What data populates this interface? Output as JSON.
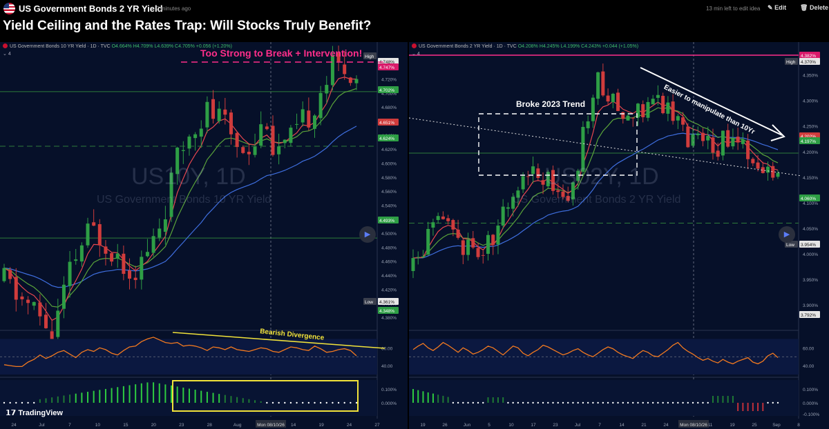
{
  "header": {
    "symbol_title": "US Government Bonds 2 YR Yield",
    "posted_ago": "2 minutes ago",
    "edit_time_left": "13 min left to edit idea",
    "edit_label": "Edit",
    "delete_label": "Delete",
    "idea_title": "Yield Ceiling and the Rates Trap: Will Stocks Truly Benefit?",
    "brand": "TradingView"
  },
  "left_pane": {
    "legend": "US Government Bonds 10 YR Yield · 1D · TVC",
    "ohlc": "O4.664%  H4.709%  L4.639%  C4.705%  +0.056 (+1.20%)",
    "indicator_count": "4",
    "watermark_symbol": "US10Y, 1D",
    "watermark_name": "US Government Bonds 10 YR Yield",
    "annotation": "Too Strong to Break + Intervention!",
    "divergence_label": "Bearish Divergence",
    "crosshair_date": "Mon 08/10/26",
    "price_tags": [
      {
        "text": "High",
        "kind": "label"
      },
      {
        "text": "4.748%",
        "kind": "high"
      },
      {
        "text": "4.747%",
        "kind": "magenta"
      },
      {
        "text": "4.702%",
        "kind": "green"
      },
      {
        "text": "4.651%",
        "kind": "red"
      },
      {
        "text": "4.624%",
        "kind": "green"
      },
      {
        "text": "4.493%",
        "kind": "green"
      },
      {
        "text": "Low",
        "kind": "label"
      },
      {
        "text": "4.361%",
        "kind": "low"
      },
      {
        "text": "4.348%",
        "kind": "green"
      }
    ]
  },
  "right_pane": {
    "legend": "US Government Bonds 2 YR Yield · 1D · TVC",
    "ohlc": "O4.208%  H4.245%  L4.199%  C4.243%  +0.044 (+1.05%)",
    "indicator_count": "4",
    "watermark_symbol": "US02Y, 1D",
    "watermark_name": "US Government Bonds 2 YR Yield",
    "annotation_trend": "Broke 2023 Trend",
    "annotation_arrow": "Easier to manipulate than 10Yr",
    "crosshair_date": "Mon 08/10/26",
    "price_tags": [
      {
        "text": "4.382%",
        "kind": "magenta"
      },
      {
        "text": "High",
        "kind": "label"
      },
      {
        "text": "4.370%",
        "kind": "high"
      },
      {
        "text": "4.202%",
        "kind": "red"
      },
      {
        "text": "4.197%",
        "kind": "green"
      },
      {
        "text": "4.060%",
        "kind": "green"
      },
      {
        "text": "Low",
        "kind": "label"
      },
      {
        "text": "3.954%",
        "kind": "low"
      },
      {
        "text": "3.792%",
        "kind": "low"
      }
    ]
  },
  "colors": {
    "bull": "#2e9e45",
    "bear": "#d03c3c",
    "ema_fast": "#e8474f",
    "ema_mid": "#5aa33a",
    "ema_slow": "#3f6fe0",
    "rsi": "#f47a1f",
    "annotation_pink": "#ff2e8a",
    "divergence": "#f2e33a"
  },
  "chart_data": [
    {
      "type": "candlestick",
      "title": "US Government Bonds 10 YR Yield · 1D · TVC",
      "y_ticks": [
        "4.740%",
        "4.720%",
        "4.700%",
        "4.680%",
        "4.660%",
        "4.640%",
        "4.620%",
        "4.600%",
        "4.580%",
        "4.560%",
        "4.540%",
        "4.520%",
        "4.500%",
        "4.480%",
        "4.460%",
        "4.440%",
        "4.420%",
        "4.400%",
        "4.380%",
        "4.360%",
        "4.340%",
        "4.320%"
      ],
      "ylim": [
        4.31,
        4.755
      ],
      "x_ticks": [
        "24",
        "Jul",
        "7",
        "10",
        "15",
        "20",
        "23",
        "28",
        "Aug",
        "11",
        "14",
        "19",
        "24",
        "27"
      ],
      "ohlc_seed": {
        "start": 4.43,
        "count": 60
      },
      "horizontal_levels": [
        4.702,
        4.624,
        4.493,
        4.348
      ],
      "rsi_ticks": [
        "60.00",
        "40.00"
      ],
      "histogram_ticks": [
        "0.100%",
        "0.000%"
      ],
      "series": [
        {
          "name": "RSI",
          "values": [
            41,
            40,
            39,
            39,
            44,
            47,
            52,
            48,
            51,
            55,
            57,
            53,
            49,
            55,
            58,
            56,
            60,
            58,
            54,
            52,
            57,
            61,
            62,
            67,
            70,
            72,
            69,
            66,
            65,
            66,
            62,
            63,
            62,
            60,
            57,
            61,
            60,
            58,
            61,
            58,
            57,
            56,
            58,
            60,
            59,
            56,
            55,
            58,
            61,
            60,
            58,
            57,
            62,
            59,
            55,
            56,
            58,
            59,
            57,
            51
          ]
        }
      ]
    },
    {
      "type": "candlestick",
      "title": "US Government Bonds 2 YR Yield · 1D · TVC",
      "y_ticks": [
        "4.350%",
        "4.300%",
        "4.250%",
        "4.200%",
        "4.150%",
        "4.100%",
        "4.050%",
        "4.000%",
        "3.950%",
        "3.900%",
        "3.850%",
        "3.800%"
      ],
      "ylim": [
        3.78,
        4.39
      ],
      "x_ticks": [
        "19",
        "26",
        "Jun",
        "5",
        "10",
        "17",
        "23",
        "Jul",
        "7",
        "14",
        "21",
        "24",
        "Aug",
        "11",
        "19",
        "25",
        "Sep",
        "8"
      ],
      "ohlc_seed": {
        "start": 3.97,
        "count": 74
      },
      "horizontal_levels": [
        4.197,
        4.06
      ],
      "rsi_ticks": [
        "60.00",
        "40.00"
      ],
      "histogram_ticks": [
        "0.100%",
        "0.000%",
        "-0.100%"
      ],
      "series": [
        {
          "name": "RSI",
          "values": [
            58,
            62,
            65,
            60,
            57,
            61,
            66,
            63,
            59,
            55,
            60,
            57,
            53,
            55,
            58,
            62,
            60,
            56,
            52,
            57,
            62,
            60,
            54,
            51,
            55,
            58,
            63,
            61,
            58,
            55,
            52,
            54,
            57,
            59,
            55,
            52,
            50,
            54,
            58,
            61,
            59,
            55,
            52,
            50,
            48,
            53,
            57,
            55,
            51,
            50,
            54,
            58,
            63,
            66,
            60,
            56,
            53,
            49,
            46,
            48,
            45,
            43,
            47,
            44,
            42,
            45,
            47,
            49,
            44,
            42,
            45,
            51,
            54,
            49
          ]
        }
      ]
    }
  ]
}
